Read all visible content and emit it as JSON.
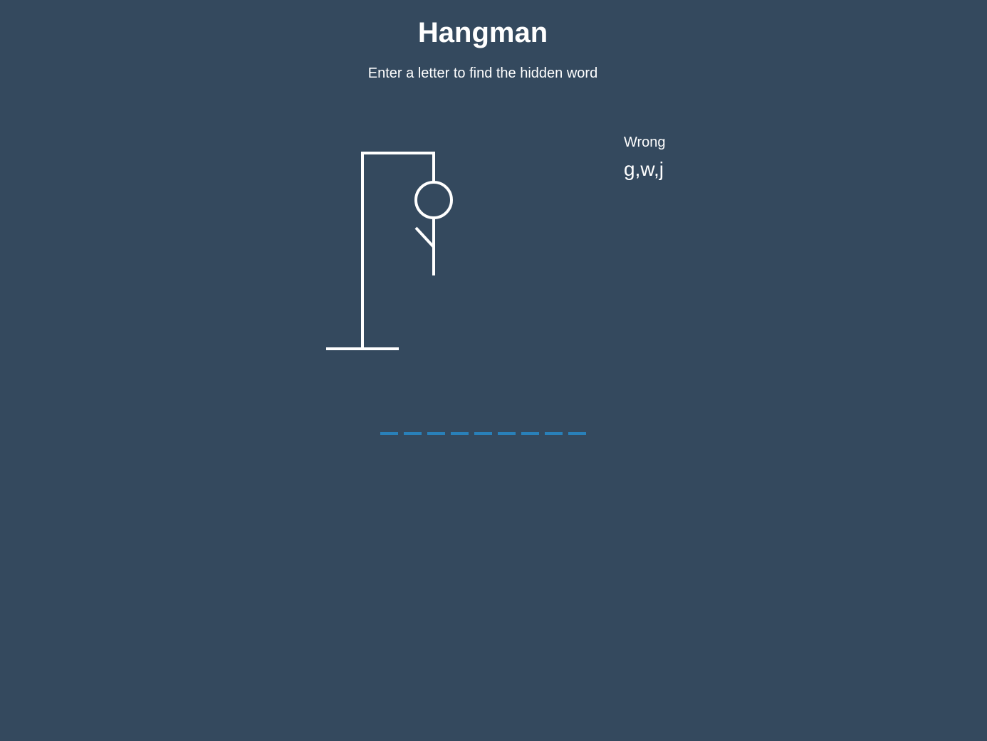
{
  "header": {
    "title": "Hangman",
    "subtitle": "Enter a letter to find the hidden word"
  },
  "wrong": {
    "label": "Wrong",
    "letters": "g,w,j"
  },
  "word": {
    "slots": [
      "",
      "",
      "",
      "",
      "",
      "",
      "",
      "",
      ""
    ],
    "underline_color": "#2980b9"
  },
  "colors": {
    "background": "#34495e",
    "figure": "#ffffff",
    "text": "#ffffff"
  }
}
